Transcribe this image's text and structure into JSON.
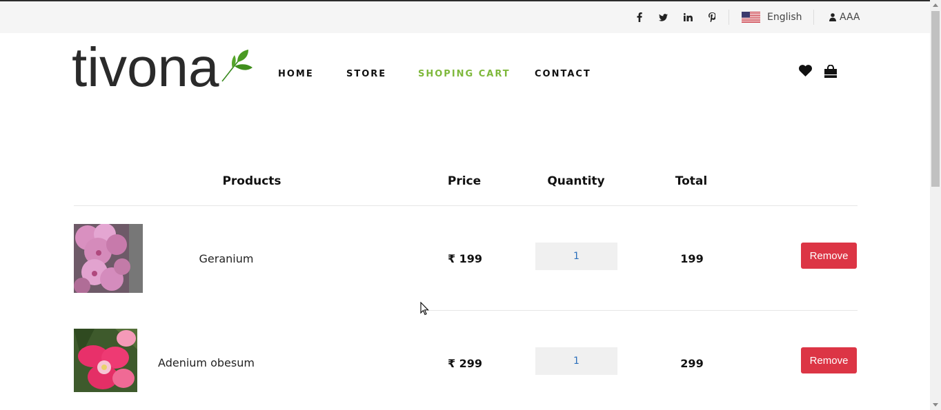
{
  "topbar": {
    "social": [
      {
        "name": "facebook-icon",
        "glyph": "f"
      },
      {
        "name": "twitter-icon",
        "glyph": "t"
      },
      {
        "name": "linkedin-icon",
        "glyph": "in"
      },
      {
        "name": "pinterest-icon",
        "glyph": "p"
      }
    ],
    "language": "English",
    "user": "AAA"
  },
  "header": {
    "logo": "tivona",
    "nav": [
      "HOME",
      "STORE",
      "SHOPING CART",
      "CONTACT"
    ],
    "active_nav": "SHOPING CART",
    "icons": [
      "heart-icon",
      "shopping-bag-icon"
    ]
  },
  "table": {
    "headers": {
      "products": "Products",
      "price": "Price",
      "quantity": "Quantity",
      "total": "Total"
    },
    "rows": [
      {
        "name": "Geranium",
        "price": "₹ 199",
        "qty": "1",
        "total": "199",
        "remove": "Remove"
      },
      {
        "name": "Adenium obesum",
        "price": "₹ 299",
        "qty": "1",
        "total": "299",
        "remove": "Remove"
      }
    ]
  },
  "colors": {
    "accent": "#7eb83b",
    "remove_button": "#dc3545",
    "topbar_bg": "#f5f5f5"
  }
}
